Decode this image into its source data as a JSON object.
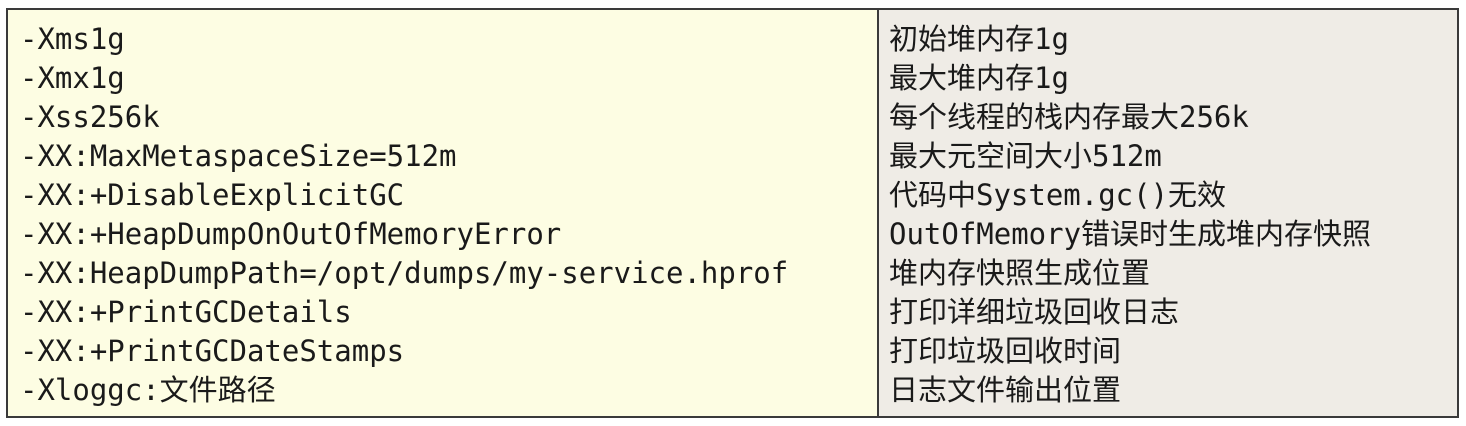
{
  "table": {
    "rows": [
      {
        "param": "-Xms1g",
        "desc": "初始堆内存1g"
      },
      {
        "param": "-Xmx1g",
        "desc": "最大堆内存1g"
      },
      {
        "param": "-Xss256k",
        "desc": "每个线程的栈内存最大256k"
      },
      {
        "param": "-XX:MaxMetaspaceSize=512m",
        "desc": "最大元空间大小512m"
      },
      {
        "param": "-XX:+DisableExplicitGC",
        "desc": "代码中System.gc()无效"
      },
      {
        "param": "-XX:+HeapDumpOnOutOfMemoryError",
        "desc": "OutOfMemory错误时生成堆内存快照"
      },
      {
        "param": "-XX:HeapDumpPath=/opt/dumps/my-service.hprof",
        "desc": "堆内存快照生成位置"
      },
      {
        "param": "-XX:+PrintGCDetails",
        "desc": "打印详细垃圾回收日志"
      },
      {
        "param": "-XX:+PrintGCDateStamps",
        "desc": "打印垃圾回收时间"
      },
      {
        "param": "-Xloggc:文件路径",
        "desc": "日志文件输出位置"
      }
    ]
  },
  "colors": {
    "left_background": "#fdfde3",
    "right_background": "#efece6",
    "border": "#3a3a3a",
    "text": "#1a1a1a"
  }
}
